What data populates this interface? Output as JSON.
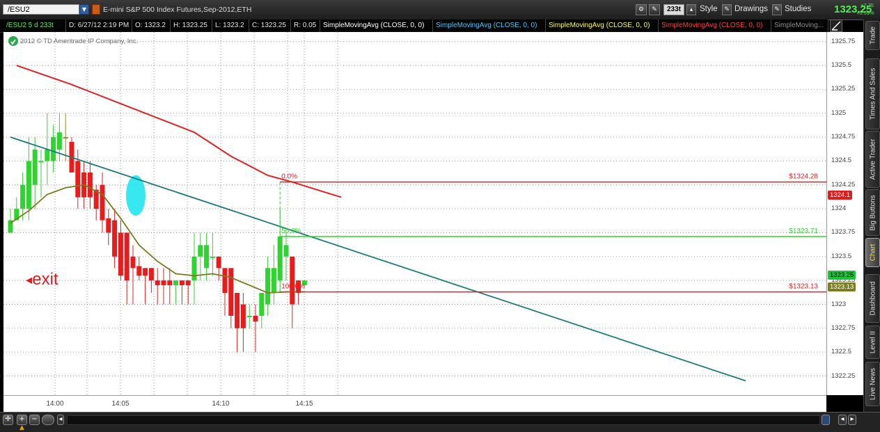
{
  "toolbar": {
    "symbol": "/ESU2",
    "instrument_desc": "E-mini S&P 500 Index Futures,Sep-2012,ETH",
    "aggregation": "233t",
    "style_label": "Style",
    "drawings_label": "Drawings",
    "studies_label": "Studies",
    "last_price": "1323.25",
    "change_abs": "+7.75",
    "change_pct": "+0.59%"
  },
  "info_row": {
    "symbol_period": "/ESU2 5 d 233t",
    "date": "D: 6/27/12 2:19 PM",
    "open": "O: 1323.2",
    "high": "H: 1323.25",
    "low": "L: 1323.2",
    "close": "C: 1323.25",
    "range": "R: 0.05",
    "studies": [
      {
        "label": "SimpleMovingAvg (CLOSE, 0, 0)",
        "color": "#ffffff"
      },
      {
        "label": "SimpleMovingAvg (CLOSE, 0, 0)",
        "color": "#39c9ff"
      },
      {
        "label": "SimpleMovingAvg (CLOSE, 0, 0)",
        "color": "#ffff33"
      },
      {
        "label": "SimpleMovingAvg (CLOSE, 0, 0)",
        "color": "#ff3b3b"
      },
      {
        "label": "SimpleMoving...",
        "color": "#8a8a8a"
      }
    ]
  },
  "chart": {
    "copyright": "2012 © TD Ameritrade IP Company, Inc.",
    "exit_label": "exit",
    "fib_labels": {
      "top": "0.0%",
      "mid": "50.0%",
      "bottom": "100.0%"
    },
    "price_labels": {
      "top": "$1324.28",
      "mid": "$1323.71",
      "bottom": "$1323.13"
    },
    "badges": {
      "red": "1324.1",
      "green": "1323.25",
      "olive": "1323.13"
    }
  },
  "chart_data": {
    "type": "candlestick",
    "ylim": [
      1322.05,
      1325.85
    ],
    "y_ticks": [
      "1325.75",
      "1325.5",
      "1325.25",
      "1325",
      "1324.75",
      "1324.5",
      "1324.25",
      "1324",
      "1323.75",
      "1323.5",
      "1323.25",
      "1323",
      "1322.75",
      "1322.5",
      "1322.25"
    ],
    "x_ticks": [
      "14:00",
      "14:05",
      "14:10",
      "14:15"
    ],
    "candles": [
      {
        "o": 1323.75,
        "h": 1324.0,
        "l": 1323.75,
        "c": 1323.88,
        "col": "g"
      },
      {
        "o": 1323.88,
        "h": 1324.12,
        "l": 1323.88,
        "c": 1324.0,
        "col": "g"
      },
      {
        "o": 1324.0,
        "h": 1324.38,
        "l": 1323.88,
        "c": 1324.25,
        "col": "g"
      },
      {
        "o": 1324.0,
        "h": 1324.75,
        "l": 1323.88,
        "c": 1324.5,
        "col": "g"
      },
      {
        "o": 1324.25,
        "h": 1324.75,
        "l": 1324.0,
        "c": 1324.62,
        "col": "g"
      },
      {
        "o": 1324.5,
        "h": 1324.62,
        "l": 1324.12,
        "c": 1324.5,
        "col": "g"
      },
      {
        "o": 1324.5,
        "h": 1325.0,
        "l": 1324.25,
        "c": 1324.62,
        "col": "g"
      },
      {
        "o": 1324.5,
        "h": 1324.88,
        "l": 1324.38,
        "c": 1324.75,
        "col": "g"
      },
      {
        "o": 1324.62,
        "h": 1325.0,
        "l": 1324.5,
        "c": 1324.8,
        "col": "g"
      },
      {
        "o": 1324.75,
        "h": 1325.0,
        "l": 1324.5,
        "c": 1324.75,
        "col": "o"
      },
      {
        "o": 1324.7,
        "h": 1324.75,
        "l": 1324.38,
        "c": 1324.38,
        "col": "r"
      },
      {
        "o": 1324.5,
        "h": 1324.62,
        "l": 1324.0,
        "c": 1324.12,
        "col": "r"
      },
      {
        "o": 1324.38,
        "h": 1324.5,
        "l": 1324.0,
        "c": 1324.12,
        "col": "r"
      },
      {
        "o": 1324.38,
        "h": 1324.5,
        "l": 1324.0,
        "c": 1324.12,
        "col": "r"
      },
      {
        "o": 1324.2,
        "h": 1324.25,
        "l": 1323.88,
        "c": 1324.0,
        "col": "r"
      },
      {
        "o": 1324.25,
        "h": 1324.38,
        "l": 1323.75,
        "c": 1323.88,
        "col": "r"
      },
      {
        "o": 1323.9,
        "h": 1324.0,
        "l": 1323.62,
        "c": 1323.75,
        "col": "r"
      },
      {
        "o": 1323.88,
        "h": 1324.0,
        "l": 1323.38,
        "c": 1323.5,
        "col": "r"
      },
      {
        "o": 1323.75,
        "h": 1323.88,
        "l": 1323.25,
        "c": 1323.3,
        "col": "r"
      },
      {
        "o": 1323.75,
        "h": 1323.75,
        "l": 1323.0,
        "c": 1323.25,
        "col": "r"
      },
      {
        "o": 1323.5,
        "h": 1323.62,
        "l": 1323.0,
        "c": 1323.38,
        "col": "r"
      },
      {
        "o": 1323.4,
        "h": 1323.5,
        "l": 1323.25,
        "c": 1323.3,
        "col": "r"
      },
      {
        "o": 1323.38,
        "h": 1323.38,
        "l": 1323.0,
        "c": 1323.3,
        "col": "r"
      },
      {
        "o": 1323.38,
        "h": 1323.38,
        "l": 1323.12,
        "c": 1323.25,
        "col": "r"
      },
      {
        "o": 1323.25,
        "h": 1323.38,
        "l": 1323.0,
        "c": 1323.2,
        "col": "r"
      },
      {
        "o": 1323.25,
        "h": 1323.38,
        "l": 1323.0,
        "c": 1323.2,
        "col": "r"
      },
      {
        "o": 1323.25,
        "h": 1323.38,
        "l": 1323.0,
        "c": 1323.2,
        "col": "r"
      },
      {
        "o": 1323.25,
        "h": 1323.25,
        "l": 1323.0,
        "c": 1323.2,
        "col": "g"
      },
      {
        "o": 1323.25,
        "h": 1323.25,
        "l": 1323.0,
        "c": 1323.2,
        "col": "r"
      },
      {
        "o": 1323.25,
        "h": 1323.25,
        "l": 1323.0,
        "c": 1323.2,
        "col": "r"
      },
      {
        "o": 1323.25,
        "h": 1323.75,
        "l": 1323.0,
        "c": 1323.5,
        "col": "g"
      },
      {
        "o": 1323.5,
        "h": 1323.75,
        "l": 1323.25,
        "c": 1323.62,
        "col": "g"
      },
      {
        "o": 1323.38,
        "h": 1323.75,
        "l": 1323.25,
        "c": 1323.62,
        "col": "g"
      },
      {
        "o": 1323.5,
        "h": 1323.75,
        "l": 1323.3,
        "c": 1323.5,
        "col": "g"
      },
      {
        "o": 1323.5,
        "h": 1323.5,
        "l": 1323.25,
        "c": 1323.38,
        "col": "r"
      },
      {
        "o": 1323.38,
        "h": 1323.38,
        "l": 1322.88,
        "c": 1323.12,
        "col": "r"
      },
      {
        "o": 1323.38,
        "h": 1323.38,
        "l": 1322.75,
        "c": 1322.88,
        "col": "r"
      },
      {
        "o": 1323.12,
        "h": 1323.12,
        "l": 1322.5,
        "c": 1322.75,
        "col": "r"
      },
      {
        "o": 1323.0,
        "h": 1323.12,
        "l": 1322.5,
        "c": 1322.75,
        "col": "r"
      },
      {
        "o": 1322.88,
        "h": 1323.0,
        "l": 1322.75,
        "c": 1322.88,
        "col": "g"
      },
      {
        "o": 1322.88,
        "h": 1323.0,
        "l": 1322.5,
        "c": 1322.82,
        "col": "r"
      },
      {
        "o": 1322.88,
        "h": 1323.12,
        "l": 1322.75,
        "c": 1323.12,
        "col": "g"
      },
      {
        "o": 1323.0,
        "h": 1323.5,
        "l": 1322.88,
        "c": 1323.38,
        "col": "g"
      },
      {
        "o": 1323.12,
        "h": 1323.62,
        "l": 1323.0,
        "c": 1323.38,
        "col": "g"
      },
      {
        "o": 1323.25,
        "h": 1324.0,
        "l": 1323.12,
        "c": 1323.71,
        "col": "g"
      },
      {
        "o": 1323.5,
        "h": 1323.75,
        "l": 1323.25,
        "c": 1323.62,
        "col": "g"
      },
      {
        "o": 1323.5,
        "h": 1323.5,
        "l": 1322.75,
        "c": 1323.0,
        "col": "r"
      },
      {
        "o": 1323.25,
        "h": 1323.25,
        "l": 1323.0,
        "c": 1323.12,
        "col": "r"
      },
      {
        "o": 1323.2,
        "h": 1323.25,
        "l": 1323.2,
        "c": 1323.25,
        "col": "g"
      }
    ],
    "sma_red": [
      [
        1,
        1325.5
      ],
      [
        10,
        1325.3
      ],
      [
        20,
        1325.05
      ],
      [
        30,
        1324.8
      ],
      [
        36,
        1324.55
      ],
      [
        42,
        1324.35
      ],
      [
        46,
        1324.28
      ],
      [
        50,
        1324.2
      ],
      [
        54,
        1324.12
      ]
    ],
    "sma_olive": [
      [
        0,
        1323.85
      ],
      [
        3,
        1323.98
      ],
      [
        6,
        1324.15
      ],
      [
        9,
        1324.22
      ],
      [
        12,
        1324.25
      ],
      [
        15,
        1324.15
      ],
      [
        18,
        1323.9
      ],
      [
        21,
        1323.62
      ],
      [
        24,
        1323.45
      ],
      [
        27,
        1323.32
      ],
      [
        30,
        1323.3
      ],
      [
        33,
        1323.32
      ],
      [
        36,
        1323.28
      ],
      [
        39,
        1323.2
      ],
      [
        42,
        1323.12
      ],
      [
        45,
        1323.13
      ],
      [
        48,
        1323.13
      ]
    ],
    "trendline": [
      [
        0,
        1324.75
      ],
      [
        120,
        1322.2
      ]
    ],
    "fib": {
      "top": 1324.28,
      "mid": 1323.71,
      "bottom": 1323.13,
      "x_start": 44
    }
  },
  "bottom": {
    "zoom_in": "+",
    "zoom_out": "−"
  },
  "right_tabs": [
    "Trade",
    "Times And Sales",
    "Active Trader",
    "Big Buttons",
    "Chart",
    "Dashboard",
    "Level II",
    "Live News"
  ]
}
